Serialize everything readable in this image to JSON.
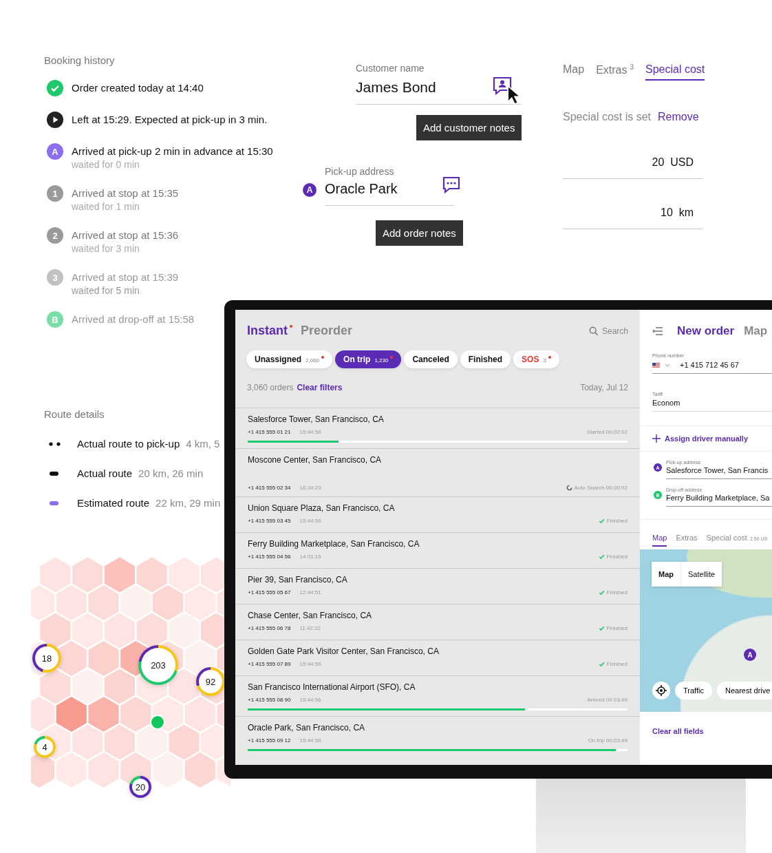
{
  "booking_history": {
    "title": "Booking history",
    "events": [
      {
        "kind": "done",
        "text": "Order created today at 14:40",
        "muted": false,
        "faded": false
      },
      {
        "kind": "started",
        "text": "Left at 15:29. Expected at pick-up in 3 min.",
        "muted": false,
        "faded": false
      },
      {
        "kind": "pickup",
        "marker": "A",
        "text": "Arrived at pick-up 2 min in advance at 15:30",
        "note": "waited for 0 min",
        "muted": false,
        "faded": false
      },
      {
        "kind": "stop",
        "marker": "1",
        "text": "Arrived at stop at 15:35",
        "note": "waited for 1 min",
        "muted": true,
        "faded": false
      },
      {
        "kind": "stop",
        "marker": "2",
        "text": "Arrived at stop at 15:36",
        "note": "waited for 3 min",
        "muted": true,
        "faded": false
      },
      {
        "kind": "stop",
        "marker": "3",
        "text": "Arrived at stop at 15:39",
        "note": "waited for 5 min",
        "muted": true,
        "faded": true
      },
      {
        "kind": "dropoff",
        "marker": "B",
        "text": "Arrived at drop-off at 15:58",
        "muted": true,
        "faded": true
      }
    ]
  },
  "customer": {
    "label": "Customer name",
    "value": "James Bond",
    "tooltip": "Add customer notes"
  },
  "pickup": {
    "label": "Pick-up address",
    "marker": "A",
    "value": "Oracle Park",
    "tooltip": "Add order notes"
  },
  "special_cost": {
    "tabs": [
      {
        "label": "Map",
        "selected": false
      },
      {
        "label": "Extras",
        "count": "3",
        "selected": false
      },
      {
        "label": "Special cost",
        "selected": true
      }
    ],
    "status": "Special cost is set",
    "action": "Remove",
    "fields": [
      {
        "value": "20",
        "unit": "USD"
      },
      {
        "value": "10",
        "unit": "km"
      }
    ]
  },
  "route_details": {
    "title": "Route details",
    "routes": [
      {
        "kind": "dots",
        "label": "Actual route to pick-up",
        "value": "4 km, 5"
      },
      {
        "kind": "solid",
        "label": "Actual route",
        "value": "20 km, 26 min"
      },
      {
        "kind": "estimated",
        "label": "Estimated route",
        "value": "22 km, 29 min"
      }
    ]
  },
  "heatmap": {
    "clusters": [
      {
        "label": "18"
      },
      {
        "label": "203"
      },
      {
        "label": "92"
      },
      {
        "label": "4"
      },
      {
        "label": "20"
      }
    ]
  },
  "dispatch": {
    "tabs": [
      {
        "label": "Instant",
        "selected": true,
        "alert": true
      },
      {
        "label": "Preorder",
        "selected": false,
        "alert": false
      }
    ],
    "search": "Search",
    "filters": [
      {
        "kind": "normal",
        "label": "Unassigned",
        "count": "2,060",
        "alert": true,
        "selected": false
      },
      {
        "kind": "normal",
        "label": "On trip",
        "count": "1,230",
        "alert": true,
        "selected": true
      },
      {
        "kind": "normal",
        "label": "Canceled",
        "alert": false,
        "selected": false
      },
      {
        "kind": "normal",
        "label": "Finished",
        "alert": false,
        "selected": false
      },
      {
        "kind": "sos",
        "label": "SOS",
        "count": "3",
        "alert": true,
        "selected": false
      }
    ],
    "order_count": "3,060 orders",
    "clear_filters": "Clear filters",
    "date": "Today, Jul 12",
    "orders": [
      {
        "address": "Salesforce Tower, San Francisco, CA",
        "phone": "+1 415 555 01 21",
        "time": "15:44:56",
        "kind": "progress",
        "status": "Started 00:02:02",
        "level": 0.24
      },
      {
        "address": "Moscone Center, San Francisco, CA",
        "phone": "+1 415 555 02 34",
        "time": "16:34:20",
        "kind": "searching",
        "status": "Auto Search 00:00:02"
      },
      {
        "address": "Union Square Plaza, San Francisco, CA",
        "phone": "+1 415 555 03 45",
        "time": "15:44:56",
        "kind": "finished",
        "status": "Finished"
      },
      {
        "address": "Ferry Building Marketplace, San Francisco, CA",
        "phone": "+1 415 555 04 56",
        "time": "14:01:15",
        "kind": "finished",
        "status": "Finished"
      },
      {
        "address": "Pier 39, San Francisco, CA",
        "phone": "+1 415 555 05 67",
        "time": "12:44:51",
        "kind": "finished",
        "status": "Finished"
      },
      {
        "address": "Chase Center, San Francisco, CA",
        "phone": "+1 415 555 06 78",
        "time": "11:42:22",
        "kind": "finished",
        "status": "Finished"
      },
      {
        "address": "Golden Gate Park Visitor Center, San Francisco, CA",
        "phone": "+1 415 555 07 89",
        "time": "15:44:56",
        "kind": "finished",
        "status": "Finished"
      },
      {
        "address": "San Francisco International Airport (SFO), CA",
        "phone": "+1 415 555 08 90",
        "time": "15:44:56",
        "kind": "progress",
        "status": "Arrived 00:03:49",
        "level": 0.73
      },
      {
        "address": "Oracle Park, San Francisco, CA",
        "phone": "+1 415 555 09 12",
        "time": "15:44:56",
        "kind": "progress",
        "status": "On trip 00:03:49",
        "level": 0.97
      }
    ]
  },
  "new_order": {
    "tabs": [
      {
        "label": "New order",
        "selected": true
      },
      {
        "label": "Map",
        "selected": false
      }
    ],
    "phone_label": "Phone number",
    "phone": "+1 415 712 45 67",
    "tariff_label": "Tariff",
    "tariff": "Econom",
    "assign": "Assign driver manually",
    "addresses": [
      {
        "marker": "A",
        "kind": "pickup",
        "label": "Pick-up address",
        "value": "Salesforce Tower, San Francis"
      },
      {
        "marker": "B",
        "kind": "dropoff",
        "label": "Drop-off address",
        "value": "Ferry Building Marketplace, Sa"
      }
    ],
    "tabs2": [
      {
        "label": "Map",
        "selected": true
      },
      {
        "label": "Extras",
        "selected": false
      },
      {
        "label": "Special cost",
        "extra": "2.50 US",
        "selected": false
      }
    ],
    "map": {
      "modes": [
        {
          "label": "Map",
          "selected": true
        },
        {
          "label": "Satellite",
          "selected": false
        }
      ],
      "marker": "A",
      "buttons": [
        "Traffic",
        "Nearest drive"
      ]
    },
    "clear": "Clear all fields"
  }
}
